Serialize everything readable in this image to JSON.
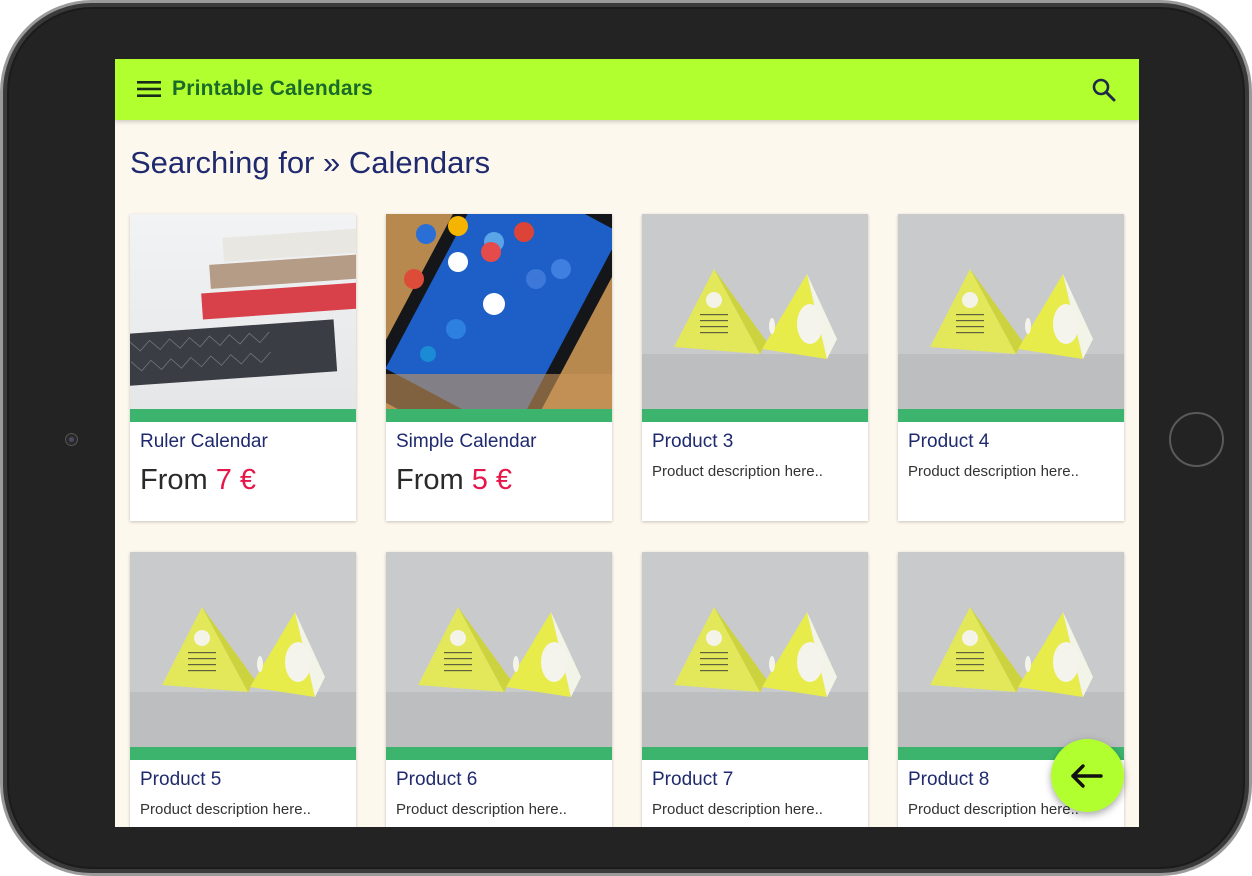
{
  "app": {
    "title": "Printable Calendars",
    "menu_icon": "menu-icon",
    "search_icon": "search-icon",
    "accent_color": "#b2ff30",
    "title_color": "#1a6b2a"
  },
  "search": {
    "heading": "Searching for » Calendars"
  },
  "products": [
    {
      "name": "Ruler Calendar",
      "price_prefix": "From",
      "price": "7 €",
      "image": "ruler-calendar-photo"
    },
    {
      "name": "Simple Calendar",
      "price_prefix": "From",
      "price": "5 €",
      "image": "smartphone-photo"
    },
    {
      "name": "Product 3",
      "description": "Product description here..",
      "image": "pyramid-calendar-photo"
    },
    {
      "name": "Product 4",
      "description": "Product description here..",
      "image": "pyramid-calendar-photo"
    },
    {
      "name": "Product 5",
      "description": "Product description here..",
      "image": "pyramid-calendar-photo"
    },
    {
      "name": "Product 6",
      "description": "Product description here..",
      "image": "pyramid-calendar-photo"
    },
    {
      "name": "Product 7",
      "description": "Product description here..",
      "image": "pyramid-calendar-photo"
    },
    {
      "name": "Product 8",
      "description": "Product description here..",
      "image": "pyramid-calendar-photo"
    }
  ],
  "fab": {
    "icon": "arrow-left-icon"
  },
  "colors": {
    "price_amount": "#e5164a",
    "card_stripe": "#3cb46e",
    "heading": "#1f2a6e",
    "screen_background": "#fdf8ee"
  }
}
